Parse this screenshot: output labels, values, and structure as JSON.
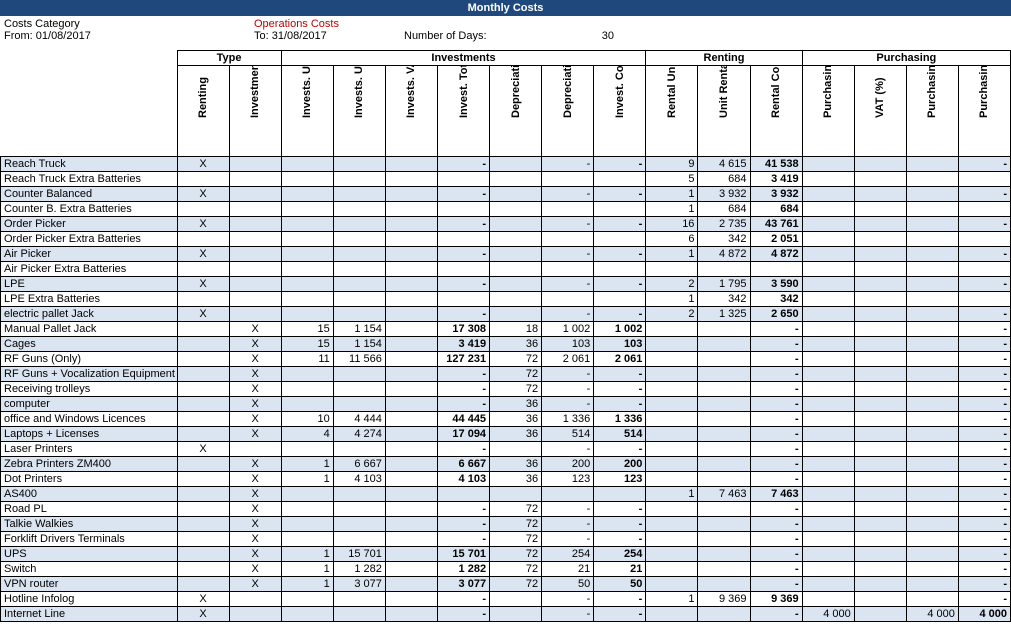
{
  "title": "Monthly Costs",
  "info": {
    "cat_label": "Costs Category",
    "cat_value": "Operations Costs",
    "from_label": "From: 01/08/2017",
    "to_label": "To: 31/08/2017",
    "days_label": "Number of Days:",
    "days_value": "30"
  },
  "groups": [
    "Type",
    "Investments",
    "Renting",
    "Purchasing"
  ],
  "columns": [
    {
      "label": "",
      "cls": "col-label"
    },
    {
      "label": "Renting",
      "cls": "col-x"
    },
    {
      "label": "Investment",
      "cls": "col-x"
    },
    {
      "label": "Invests. Units",
      "cls": "col-n"
    },
    {
      "label": "Invests. Unit Cost",
      "cls": "col-m"
    },
    {
      "label": "Invests. VAT (%)",
      "cls": "col-n"
    },
    {
      "label": "Invest. Total Cost at Purchase",
      "cls": "col-w bold"
    },
    {
      "label": "Depreciation period",
      "cls": "col-n"
    },
    {
      "label": "Depreciation Cost per month",
      "cls": "col-m"
    },
    {
      "label": "Invest. Costs",
      "cls": "col-m bold"
    },
    {
      "label": "Rental Units",
      "cls": "col-n"
    },
    {
      "label": "Unit Rental Cost per month",
      "cls": "col-m"
    },
    {
      "label": "Rental Costs",
      "cls": "col-m bold"
    },
    {
      "label": "Purchasing Unit Cost",
      "cls": "col-m"
    },
    {
      "label": "VAT (%)",
      "cls": "col-n"
    },
    {
      "label": "Purchasing Units",
      "cls": "col-m"
    },
    {
      "label": "Purchasing Costs",
      "cls": "col-m bold"
    }
  ],
  "rows": [
    {
      "label": "Reach Truck",
      "r": "X",
      "i": "",
      "iu": "",
      "iuc": "",
      "ivat": "",
      "itc": "-",
      "dp": "",
      "dcm": "-",
      "ic": "-",
      "ru": "9",
      "urc": "4 615",
      "rc": "41 538",
      "puc": "",
      "pvat": "",
      "pu": "",
      "pc": "-"
    },
    {
      "label": "Reach Truck Extra Batteries",
      "r": "",
      "i": "",
      "iu": "",
      "iuc": "",
      "ivat": "",
      "itc": "",
      "dp": "",
      "dcm": "",
      "ic": "",
      "ru": "5",
      "urc": "684",
      "rc": "3 419",
      "puc": "",
      "pvat": "",
      "pu": "",
      "pc": ""
    },
    {
      "label": "Counter Balanced",
      "r": "X",
      "i": "",
      "iu": "",
      "iuc": "",
      "ivat": "",
      "itc": "-",
      "dp": "",
      "dcm": "-",
      "ic": "-",
      "ru": "1",
      "urc": "3 932",
      "rc": "3 932",
      "puc": "",
      "pvat": "",
      "pu": "",
      "pc": "-"
    },
    {
      "label": "Counter B. Extra Batteries",
      "r": "",
      "i": "",
      "iu": "",
      "iuc": "",
      "ivat": "",
      "itc": "",
      "dp": "",
      "dcm": "",
      "ic": "",
      "ru": "1",
      "urc": "684",
      "rc": "684",
      "puc": "",
      "pvat": "",
      "pu": "",
      "pc": ""
    },
    {
      "label": "Order Picker",
      "r": "X",
      "i": "",
      "iu": "",
      "iuc": "",
      "ivat": "",
      "itc": "-",
      "dp": "",
      "dcm": "-",
      "ic": "-",
      "ru": "16",
      "urc": "2 735",
      "rc": "43 761",
      "puc": "",
      "pvat": "",
      "pu": "",
      "pc": "-"
    },
    {
      "label": "Order Picker Extra Batteries",
      "r": "",
      "i": "",
      "iu": "",
      "iuc": "",
      "ivat": "",
      "itc": "",
      "dp": "",
      "dcm": "",
      "ic": "",
      "ru": "6",
      "urc": "342",
      "rc": "2 051",
      "puc": "",
      "pvat": "",
      "pu": "",
      "pc": ""
    },
    {
      "label": "Air Picker",
      "r": "X",
      "i": "",
      "iu": "",
      "iuc": "",
      "ivat": "",
      "itc": "-",
      "dp": "",
      "dcm": "-",
      "ic": "-",
      "ru": "1",
      "urc": "4 872",
      "rc": "4 872",
      "puc": "",
      "pvat": "",
      "pu": "",
      "pc": "-"
    },
    {
      "label": "Air Picker Extra Batteries",
      "r": "",
      "i": "",
      "iu": "",
      "iuc": "",
      "ivat": "",
      "itc": "",
      "dp": "",
      "dcm": "",
      "ic": "",
      "ru": "",
      "urc": "",
      "rc": "",
      "puc": "",
      "pvat": "",
      "pu": "",
      "pc": ""
    },
    {
      "label": "LPE",
      "r": "X",
      "i": "",
      "iu": "",
      "iuc": "",
      "ivat": "",
      "itc": "-",
      "dp": "",
      "dcm": "-",
      "ic": "-",
      "ru": "2",
      "urc": "1 795",
      "rc": "3 590",
      "puc": "",
      "pvat": "",
      "pu": "",
      "pc": "-"
    },
    {
      "label": "LPE Extra Batteries",
      "r": "",
      "i": "",
      "iu": "",
      "iuc": "",
      "ivat": "",
      "itc": "",
      "dp": "",
      "dcm": "",
      "ic": "",
      "ru": "1",
      "urc": "342",
      "rc": "342",
      "puc": "",
      "pvat": "",
      "pu": "",
      "pc": ""
    },
    {
      "label": "electric pallet Jack",
      "r": "X",
      "i": "",
      "iu": "",
      "iuc": "",
      "ivat": "",
      "itc": "-",
      "dp": "",
      "dcm": "-",
      "ic": "-",
      "ru": "2",
      "urc": "1 325",
      "rc": "2 650",
      "puc": "",
      "pvat": "",
      "pu": "",
      "pc": "-"
    },
    {
      "label": "Manual Pallet Jack",
      "r": "",
      "i": "X",
      "iu": "15",
      "iuc": "1 154",
      "ivat": "",
      "itc": "17 308",
      "dp": "18",
      "dcm": "1 002",
      "ic": "1 002",
      "ru": "",
      "urc": "",
      "rc": "-",
      "puc": "",
      "pvat": "",
      "pu": "",
      "pc": "-"
    },
    {
      "label": "Cages",
      "r": "",
      "i": "X",
      "iu": "15",
      "iuc": "1 154",
      "ivat": "",
      "itc": "3 419",
      "dp": "36",
      "dcm": "103",
      "ic": "103",
      "ru": "",
      "urc": "",
      "rc": "-",
      "puc": "",
      "pvat": "",
      "pu": "",
      "pc": "-"
    },
    {
      "label": "RF Guns (Only)",
      "r": "",
      "i": "X",
      "iu": "11",
      "iuc": "11 566",
      "ivat": "",
      "itc": "127 231",
      "dp": "72",
      "dcm": "2 061",
      "ic": "2 061",
      "ru": "",
      "urc": "",
      "rc": "-",
      "puc": "",
      "pvat": "",
      "pu": "",
      "pc": "-"
    },
    {
      "label": "RF Guns + Vocalization Equipment",
      "r": "",
      "i": "X",
      "iu": "",
      "iuc": "",
      "ivat": "",
      "itc": "-",
      "dp": "72",
      "dcm": "-",
      "ic": "-",
      "ru": "",
      "urc": "",
      "rc": "-",
      "puc": "",
      "pvat": "",
      "pu": "",
      "pc": "-"
    },
    {
      "label": "Receiving trolleys",
      "r": "",
      "i": "X",
      "iu": "",
      "iuc": "",
      "ivat": "",
      "itc": "-",
      "dp": "72",
      "dcm": "-",
      "ic": "-",
      "ru": "",
      "urc": "",
      "rc": "-",
      "puc": "",
      "pvat": "",
      "pu": "",
      "pc": "-"
    },
    {
      "label": "computer",
      "r": "",
      "i": "X",
      "iu": "",
      "iuc": "",
      "ivat": "",
      "itc": "-",
      "dp": "36",
      "dcm": "-",
      "ic": "-",
      "ru": "",
      "urc": "",
      "rc": "-",
      "puc": "",
      "pvat": "",
      "pu": "",
      "pc": "-"
    },
    {
      "label": "office and Windows Licences",
      "r": "",
      "i": "X",
      "iu": "10",
      "iuc": "4 444",
      "ivat": "",
      "itc": "44 445",
      "dp": "36",
      "dcm": "1 336",
      "ic": "1 336",
      "ru": "",
      "urc": "",
      "rc": "-",
      "puc": "",
      "pvat": "",
      "pu": "",
      "pc": "-"
    },
    {
      "label": "Laptops + Licenses",
      "r": "",
      "i": "X",
      "iu": "4",
      "iuc": "4 274",
      "ivat": "",
      "itc": "17 094",
      "dp": "36",
      "dcm": "514",
      "ic": "514",
      "ru": "",
      "urc": "",
      "rc": "-",
      "puc": "",
      "pvat": "",
      "pu": "",
      "pc": "-"
    },
    {
      "label": "Laser Printers",
      "r": "X",
      "i": "",
      "iu": "",
      "iuc": "",
      "ivat": "",
      "itc": "-",
      "dp": "",
      "dcm": "-",
      "ic": "-",
      "ru": "",
      "urc": "",
      "rc": "-",
      "puc": "",
      "pvat": "",
      "pu": "",
      "pc": "-"
    },
    {
      "label": "Zebra Printers ZM400",
      "r": "",
      "i": "X",
      "iu": "1",
      "iuc": "6 667",
      "ivat": "",
      "itc": "6 667",
      "dp": "36",
      "dcm": "200",
      "ic": "200",
      "ru": "",
      "urc": "",
      "rc": "-",
      "puc": "",
      "pvat": "",
      "pu": "",
      "pc": "-"
    },
    {
      "label": "Dot Printers",
      "r": "",
      "i": "X",
      "iu": "1",
      "iuc": "4 103",
      "ivat": "",
      "itc": "4 103",
      "dp": "36",
      "dcm": "123",
      "ic": "123",
      "ru": "",
      "urc": "",
      "rc": "-",
      "puc": "",
      "pvat": "",
      "pu": "",
      "pc": "-"
    },
    {
      "label": "AS400",
      "r": "",
      "i": "X",
      "iu": "",
      "iuc": "",
      "ivat": "",
      "itc": "",
      "dp": "",
      "dcm": "",
      "ic": "",
      "ru": "1",
      "urc": "7 463",
      "rc": "7 463",
      "puc": "",
      "pvat": "",
      "pu": "",
      "pc": "-"
    },
    {
      "label": "Road PL",
      "r": "",
      "i": "X",
      "iu": "",
      "iuc": "",
      "ivat": "",
      "itc": "-",
      "dp": "72",
      "dcm": "-",
      "ic": "-",
      "ru": "",
      "urc": "",
      "rc": "-",
      "puc": "",
      "pvat": "",
      "pu": "",
      "pc": "-"
    },
    {
      "label": "Talkie Walkies",
      "r": "",
      "i": "X",
      "iu": "",
      "iuc": "",
      "ivat": "",
      "itc": "-",
      "dp": "72",
      "dcm": "-",
      "ic": "-",
      "ru": "",
      "urc": "",
      "rc": "-",
      "puc": "",
      "pvat": "",
      "pu": "",
      "pc": "-"
    },
    {
      "label": "Forklift Drivers Terminals",
      "r": "",
      "i": "X",
      "iu": "",
      "iuc": "",
      "ivat": "",
      "itc": "-",
      "dp": "72",
      "dcm": "-",
      "ic": "-",
      "ru": "",
      "urc": "",
      "rc": "-",
      "puc": "",
      "pvat": "",
      "pu": "",
      "pc": "-"
    },
    {
      "label": "UPS",
      "r": "",
      "i": "X",
      "iu": "1",
      "iuc": "15 701",
      "ivat": "",
      "itc": "15 701",
      "dp": "72",
      "dcm": "254",
      "ic": "254",
      "ru": "",
      "urc": "",
      "rc": "-",
      "puc": "",
      "pvat": "",
      "pu": "",
      "pc": "-"
    },
    {
      "label": "Switch",
      "r": "",
      "i": "X",
      "iu": "1",
      "iuc": "1 282",
      "ivat": "",
      "itc": "1 282",
      "dp": "72",
      "dcm": "21",
      "ic": "21",
      "ru": "",
      "urc": "",
      "rc": "-",
      "puc": "",
      "pvat": "",
      "pu": "",
      "pc": "-"
    },
    {
      "label": "VPN router",
      "r": "",
      "i": "X",
      "iu": "1",
      "iuc": "3 077",
      "ivat": "",
      "itc": "3 077",
      "dp": "72",
      "dcm": "50",
      "ic": "50",
      "ru": "",
      "urc": "",
      "rc": "-",
      "puc": "",
      "pvat": "",
      "pu": "",
      "pc": "-"
    },
    {
      "label": "Hotline Infolog",
      "r": "X",
      "i": "",
      "iu": "",
      "iuc": "",
      "ivat": "",
      "itc": "-",
      "dp": "",
      "dcm": "-",
      "ic": "-",
      "ru": "1",
      "urc": "9 369",
      "rc": "9 369",
      "puc": "",
      "pvat": "",
      "pu": "",
      "pc": "-"
    },
    {
      "label": "Internet Line",
      "r": "X",
      "i": "",
      "iu": "",
      "iuc": "",
      "ivat": "",
      "itc": "-",
      "dp": "",
      "dcm": "-",
      "ic": "-",
      "ru": "",
      "urc": "",
      "rc": "-",
      "puc": "4 000",
      "pvat": "",
      "pu": "4 000",
      "pc": "4 000"
    }
  ]
}
